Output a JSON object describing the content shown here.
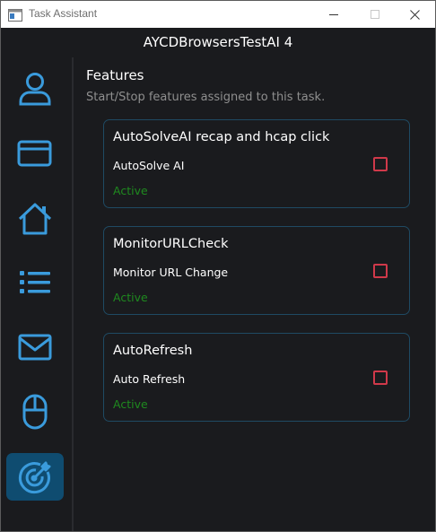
{
  "window": {
    "title": "Task Assistant",
    "controls": {
      "minimize": "minimize-icon",
      "maximize": "maximize-icon",
      "close": "close-icon"
    }
  },
  "header": {
    "title": "AYCDBrowsersTestAI 4"
  },
  "sidebar": {
    "accent_color": "#3a9bdc",
    "active_background": "#0f4c70",
    "items": [
      {
        "icon": "user-icon",
        "active": false
      },
      {
        "icon": "credit-card-icon",
        "active": false
      },
      {
        "icon": "home-icon",
        "active": false
      },
      {
        "icon": "list-icon",
        "active": false
      },
      {
        "icon": "mail-icon",
        "active": false
      },
      {
        "icon": "mouse-icon",
        "active": false
      },
      {
        "icon": "target-icon",
        "active": true
      }
    ]
  },
  "main": {
    "title": "Features",
    "subtitle": "Start/Stop features assigned to this task.",
    "features": [
      {
        "title": "AutoSolveAI recap and hcap click",
        "label": "AutoSolve AI",
        "status": "Active",
        "checked": false
      },
      {
        "title": "MonitorURLCheck",
        "label": "Monitor URL Change",
        "status": "Active",
        "checked": false
      },
      {
        "title": "AutoRefresh",
        "label": "Auto Refresh",
        "status": "Active",
        "checked": false
      }
    ]
  },
  "colors": {
    "background": "#1a1b1e",
    "card_border": "#1f4a63",
    "status_active": "#1f8a1f",
    "checkbox": "#d0394a"
  }
}
